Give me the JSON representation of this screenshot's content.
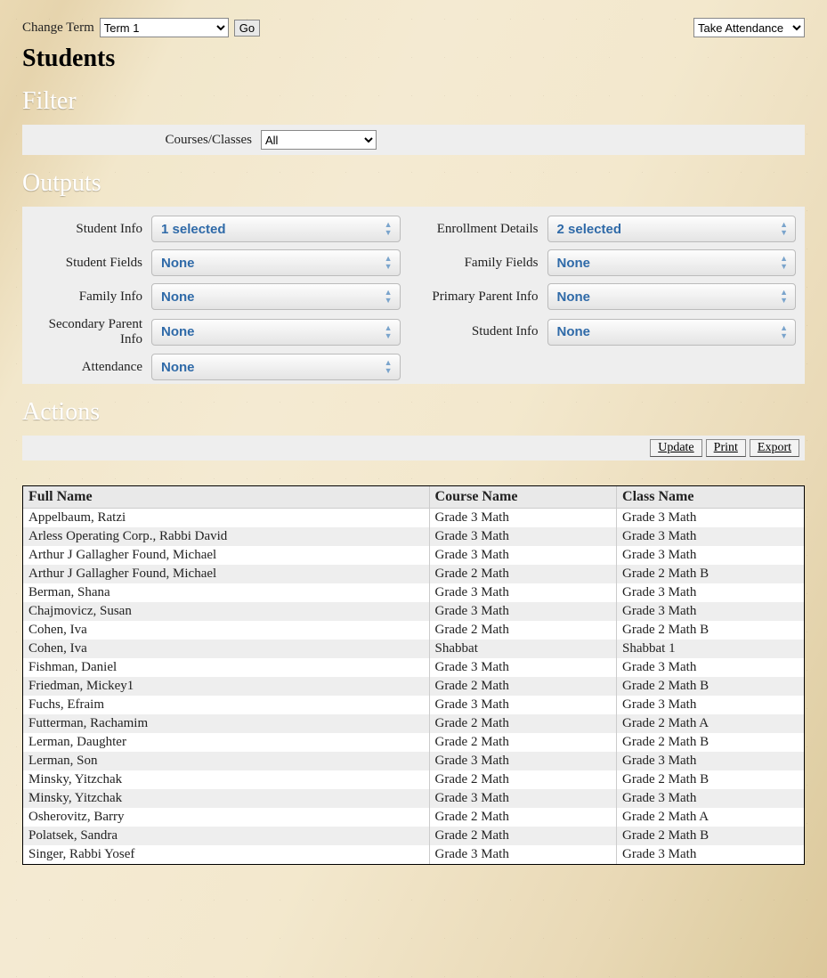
{
  "topbar": {
    "change_term_label": "Change Term",
    "term_value": "Term 1",
    "go_label": "Go",
    "take_attendance_value": "Take Attendance"
  },
  "page_title": "Students",
  "sections": {
    "filter": "Filter",
    "outputs": "Outputs",
    "actions": "Actions"
  },
  "filter": {
    "courses_label": "Courses/Classes",
    "courses_value": "All"
  },
  "outputs": {
    "left": [
      {
        "label": "Student Info",
        "value": "1 selected"
      },
      {
        "label": "Student Fields",
        "value": "None"
      },
      {
        "label": "Family Info",
        "value": "None"
      },
      {
        "label": "Secondary Parent Info",
        "value": "None"
      },
      {
        "label": "Attendance",
        "value": "None"
      }
    ],
    "right": [
      {
        "label": "Enrollment Details",
        "value": "2 selected"
      },
      {
        "label": "Family Fields",
        "value": "None"
      },
      {
        "label": "Primary Parent Info",
        "value": "None"
      },
      {
        "label": "Student Info",
        "value": "None"
      }
    ]
  },
  "actions": {
    "update": "Update",
    "print": "Print",
    "export": "Export"
  },
  "table": {
    "columns": [
      "Full Name",
      "Course Name",
      "Class Name"
    ],
    "rows": [
      [
        "Appelbaum, Ratzi",
        "Grade 3 Math",
        "Grade 3 Math"
      ],
      [
        "Arless Operating Corp., Rabbi David",
        "Grade 3 Math",
        "Grade 3 Math"
      ],
      [
        "Arthur J Gallagher Found, Michael",
        "Grade 3 Math",
        "Grade 3 Math"
      ],
      [
        "Arthur J Gallagher Found, Michael",
        "Grade 2 Math",
        "Grade 2 Math B"
      ],
      [
        "Berman, Shana",
        "Grade 3 Math",
        "Grade 3 Math"
      ],
      [
        "Chajmovicz, Susan",
        "Grade 3 Math",
        "Grade 3 Math"
      ],
      [
        "Cohen, Iva",
        "Grade 2 Math",
        "Grade 2 Math B"
      ],
      [
        "Cohen, Iva",
        "Shabbat",
        "Shabbat 1"
      ],
      [
        "Fishman, Daniel",
        "Grade 3 Math",
        "Grade 3 Math"
      ],
      [
        "Friedman, Mickey1",
        "Grade 2 Math",
        "Grade 2 Math B"
      ],
      [
        "Fuchs, Efraim",
        "Grade 3 Math",
        "Grade 3 Math"
      ],
      [
        "Futterman, Rachamim",
        "Grade 2 Math",
        "Grade 2 Math A"
      ],
      [
        "Lerman, Daughter",
        "Grade 2 Math",
        "Grade 2 Math B"
      ],
      [
        "Lerman, Son",
        "Grade 3 Math",
        "Grade 3 Math"
      ],
      [
        "Minsky, Yitzchak",
        "Grade 2 Math",
        "Grade 2 Math B"
      ],
      [
        "Minsky, Yitzchak",
        "Grade 3 Math",
        "Grade 3 Math"
      ],
      [
        "Osherovitz, Barry",
        "Grade 2 Math",
        "Grade 2 Math A"
      ],
      [
        "Polatsek, Sandra",
        "Grade 2 Math",
        "Grade 2 Math B"
      ],
      [
        "Singer, Rabbi Yosef",
        "Grade 3 Math",
        "Grade 3 Math"
      ]
    ]
  }
}
